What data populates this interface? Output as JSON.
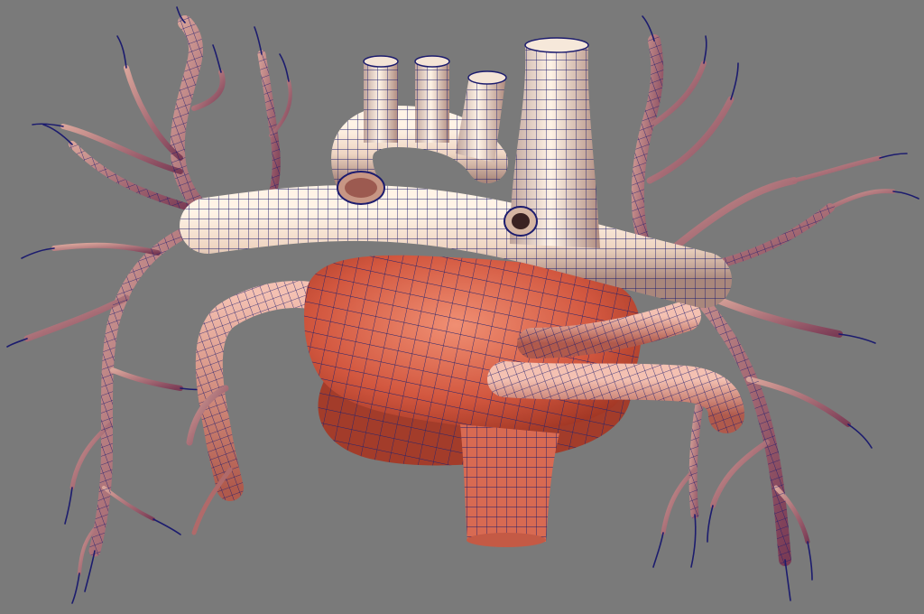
{
  "viewport": {
    "background_color": "#7a7a7a"
  },
  "model": {
    "subject": "heart-vessels-wireframe-icon",
    "mesh_line_color": "#1c1c6e",
    "vessel_cream_color": "#f1dccb",
    "vessel_pink_color": "#e9a592",
    "chamber_red_color": "#d2573f",
    "chamber_dark_color": "#9c3321"
  }
}
